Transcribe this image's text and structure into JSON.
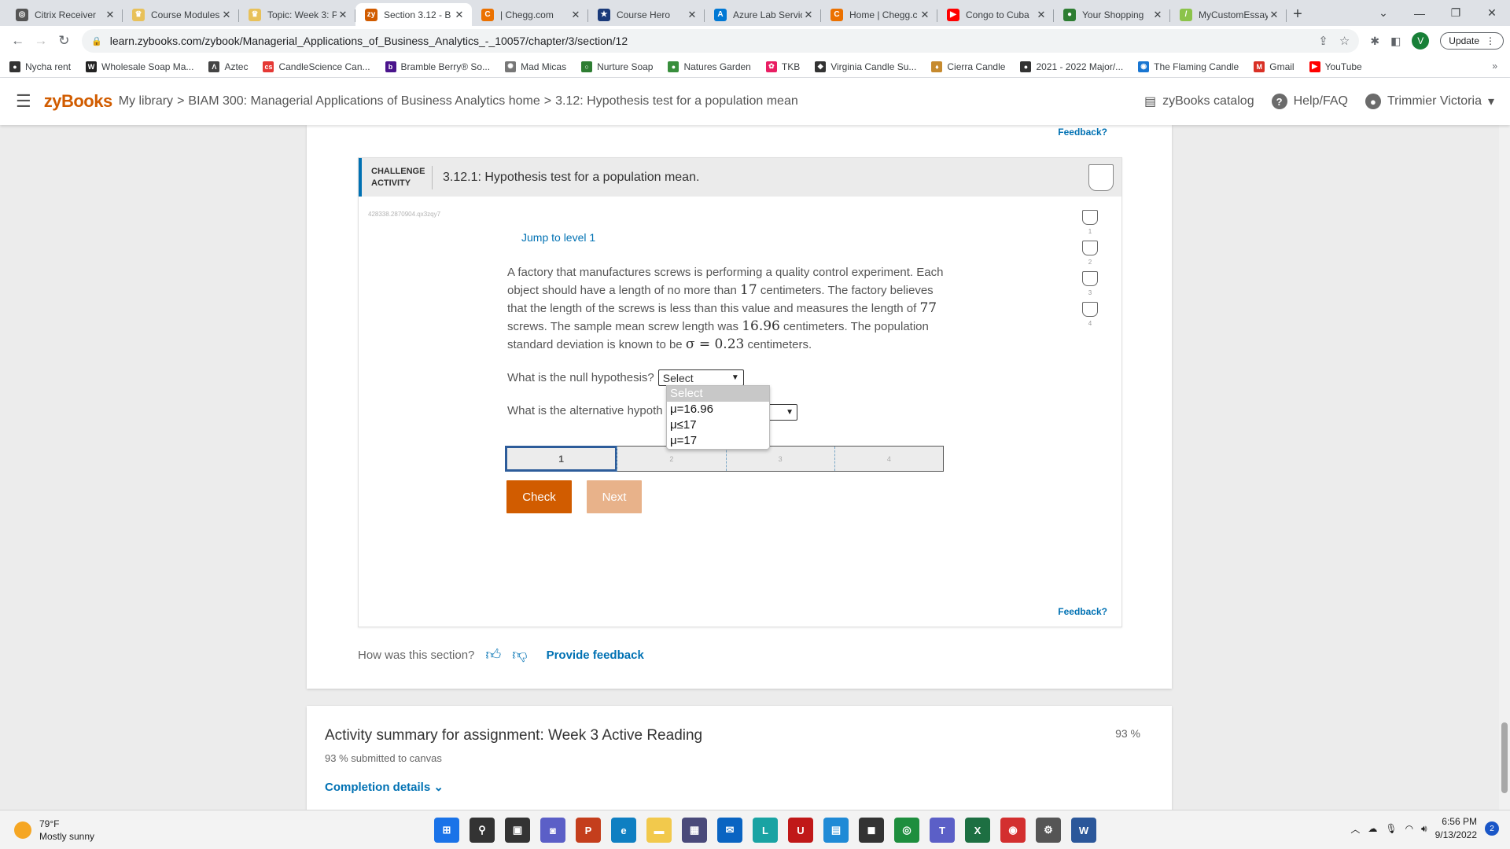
{
  "browser": {
    "tabs": [
      {
        "label": "Citrix Receiver",
        "icon": "citrix-icon",
        "color": "#555555",
        "glyph": "◎"
      },
      {
        "label": "Course Modules",
        "icon": "canvas-icon",
        "color": "#e8c15a",
        "glyph": "♛"
      },
      {
        "label": "Topic: Week 3: P",
        "icon": "canvas-icon",
        "color": "#e8c15a",
        "glyph": "♛"
      },
      {
        "label": "Section 3.12 - B",
        "icon": "zybooks-icon",
        "color": "#d15c00",
        "glyph": "zy",
        "active": true
      },
      {
        "label": "| Chegg.com",
        "icon": "chegg-icon",
        "color": "#eb7100",
        "glyph": "C"
      },
      {
        "label": "Course Hero",
        "icon": "coursehero-icon",
        "color": "#1a3a7a",
        "glyph": "★"
      },
      {
        "label": "Azure Lab Servic",
        "icon": "azure-icon",
        "color": "#0078d4",
        "glyph": "A"
      },
      {
        "label": "Home | Chegg.c",
        "icon": "chegg-icon",
        "color": "#eb7100",
        "glyph": "C"
      },
      {
        "label": "Congo to Cuba",
        "icon": "youtube-icon",
        "color": "#ff0000",
        "glyph": "▶"
      },
      {
        "label": "Your Shopping",
        "icon": "shopping-icon",
        "color": "#2e7d32",
        "glyph": "●"
      },
      {
        "label": "MyCustomEssay",
        "icon": "pen-icon",
        "color": "#8bc34a",
        "glyph": "/"
      }
    ],
    "new_tab": "+",
    "address": "learn.zybooks.com/zybook/Managerial_Applications_of_Business_Analytics_-_10057/chapter/3/section/12",
    "profile_initial": "V",
    "update_label": "Update",
    "bookmarks": [
      {
        "label": "Nycha rent",
        "color": "#333333",
        "glyph": "●"
      },
      {
        "label": "Wholesale Soap Ma...",
        "color": "#222222",
        "glyph": "W"
      },
      {
        "label": "Aztec",
        "color": "#444444",
        "glyph": "Λ"
      },
      {
        "label": "CandleScience Can...",
        "color": "#e53935",
        "glyph": "cs"
      },
      {
        "label": "Bramble Berry® So...",
        "color": "#4a148c",
        "glyph": "b"
      },
      {
        "label": "Mad Micas",
        "color": "#777777",
        "glyph": "✺"
      },
      {
        "label": "Nurture Soap",
        "color": "#2e7d32",
        "glyph": "○"
      },
      {
        "label": "Natures Garden",
        "color": "#388e3c",
        "glyph": "●"
      },
      {
        "label": "TKB",
        "color": "#e91e63",
        "glyph": "✿"
      },
      {
        "label": "Virginia Candle Su...",
        "color": "#333333",
        "glyph": "◆"
      },
      {
        "label": "Cierra Candle",
        "color": "#c68a2e",
        "glyph": "♦"
      },
      {
        "label": "2021 - 2022 Major/...",
        "color": "#333333",
        "glyph": "●"
      },
      {
        "label": "The Flaming Candle",
        "color": "#1976d2",
        "glyph": "◉"
      },
      {
        "label": "Gmail",
        "color": "#d93025",
        "glyph": "M"
      },
      {
        "label": "YouTube",
        "color": "#ff0000",
        "glyph": "▶"
      }
    ],
    "more": "»"
  },
  "header": {
    "logo": "zyBooks",
    "crumbs": [
      "My library",
      "BIAM 300: Managerial Applications of Business Analytics home",
      "3.12: Hypothesis test for a population mean"
    ],
    "sep": ">",
    "catalog": "zyBooks catalog",
    "help": "Help/FAQ",
    "user": "Trimmier Victoria"
  },
  "activity": {
    "feedback_top": "Feedback?",
    "tag_line1": "CHALLENGE",
    "tag_line2": "ACTIVITY",
    "title": "3.12.1: Hypothesis test for a population mean.",
    "id": "428338.2870904.qx3zqy7",
    "jump": "Jump to level 1",
    "prompt": {
      "p1": "A factory that manufactures screws is performing a quality control experiment. Each object should have a length of no more than ",
      "n1": "17",
      "p2": " centimeters. The factory believes that the length of the screws is less than this value and measures the length of ",
      "n2": "77",
      "p3": " screws. The sample mean screw length was ",
      "n3": "16.96",
      "p4": " centimeters. The population standard deviation is known to be ",
      "n4": "σ = 0.23",
      "p5": " centimeters."
    },
    "q1_label": "What is the null hypothesis?",
    "q1_selected": "Select",
    "q2_label": "What is the alternative hypoth",
    "dropdown_options": [
      "Select",
      "μ=16.96",
      "μ≤17",
      "μ=17"
    ],
    "levels": [
      "1",
      "2",
      "3",
      "4"
    ],
    "progress": [
      "1",
      "2",
      "3",
      "4"
    ],
    "check": "Check",
    "next": "Next",
    "feedback_bottom": "Feedback?"
  },
  "section_feedback": {
    "question": "How was this section?",
    "provide": "Provide feedback"
  },
  "summary": {
    "title": "Activity summary for assignment: Week 3 Active Reading",
    "submitted": "93 % submitted to canvas",
    "percent": "93 %",
    "details": "Completion details"
  },
  "taskbar": {
    "temp": "79°F",
    "weather": "Mostly sunny",
    "time": "6:56 PM",
    "date": "9/13/2022",
    "notifications": "2",
    "apps": [
      {
        "name": "windows-start-icon",
        "color": "#1a73e8",
        "glyph": "⊞"
      },
      {
        "name": "search-icon",
        "color": "#333333",
        "glyph": "⚲"
      },
      {
        "name": "task-view-icon",
        "color": "#333333",
        "glyph": "▣"
      },
      {
        "name": "chat-icon",
        "color": "#5b5fc7",
        "glyph": "◙"
      },
      {
        "name": "powerpoint-icon",
        "color": "#c43e1c",
        "glyph": "P"
      },
      {
        "name": "edge-icon",
        "color": "#0f7fc2",
        "glyph": "e"
      },
      {
        "name": "file-explorer-icon",
        "color": "#f2c94c",
        "glyph": "▬"
      },
      {
        "name": "store-icon",
        "color": "#4a4a7a",
        "glyph": "▦"
      },
      {
        "name": "mail-icon",
        "color": "#0a64c2",
        "glyph": "✉"
      },
      {
        "name": "lockdown-icon",
        "color": "#19a3a3",
        "glyph": "L"
      },
      {
        "name": "mcafee-icon",
        "color": "#c01818",
        "glyph": "U"
      },
      {
        "name": "calculator-icon",
        "color": "#1f8ad6",
        "glyph": "▤"
      },
      {
        "name": "media-icon",
        "color": "#333333",
        "glyph": "◼"
      },
      {
        "name": "chrome-icon",
        "color": "#1e8e3e",
        "glyph": "◎"
      },
      {
        "name": "teams-icon",
        "color": "#5b5fc7",
        "glyph": "T"
      },
      {
        "name": "excel-icon",
        "color": "#1d6f42",
        "glyph": "X"
      },
      {
        "name": "camera-icon",
        "color": "#d32f2f",
        "glyph": "◉"
      },
      {
        "name": "settings-icon",
        "color": "#555555",
        "glyph": "⚙"
      },
      {
        "name": "word-icon",
        "color": "#2b579a",
        "glyph": "W"
      }
    ]
  }
}
